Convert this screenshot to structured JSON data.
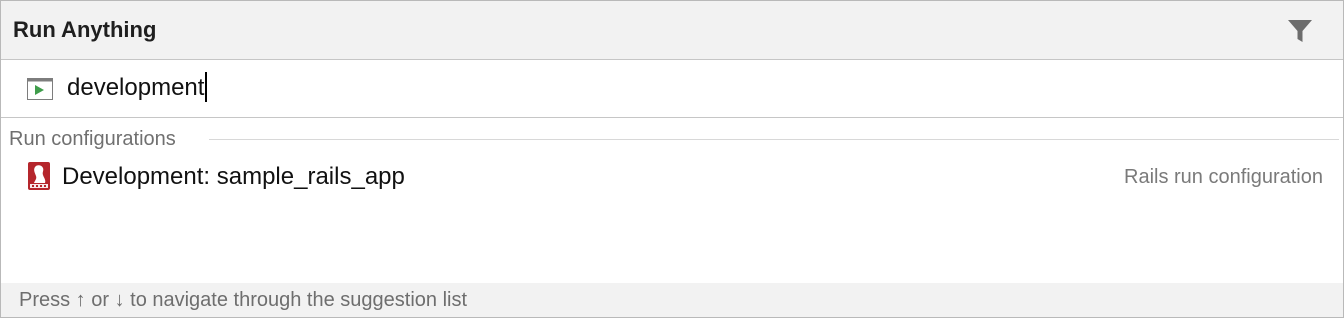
{
  "popup": {
    "title": "Run Anything",
    "filter_icon": "filter-icon"
  },
  "search": {
    "icon": "run-console-icon",
    "value": "development"
  },
  "results": {
    "section_label": "Run configurations",
    "items": [
      {
        "icon": "rails-icon",
        "label": "Development: sample_rails_app",
        "type": "Rails run configuration"
      }
    ]
  },
  "footer": {
    "hint": "Press ↑ or ↓ to navigate through the suggestion list"
  },
  "colors": {
    "header_bg": "#f2f2f2",
    "run_icon_green": "#3f9d4b",
    "rails_red": "#b5262c"
  }
}
